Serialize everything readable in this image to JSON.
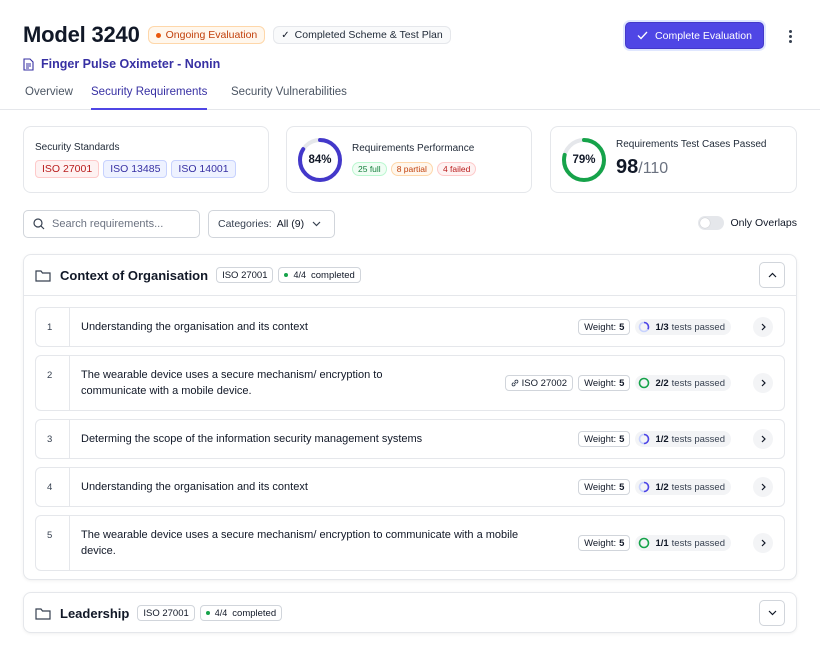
{
  "header": {
    "model_title": "Model 3240",
    "status_badge": "Ongoing Evaluation",
    "scheme_badge": "Completed Scheme & Test Plan",
    "device_name": "Finger Pulse Oximeter - Nonin",
    "complete_button": "Complete Evaluation"
  },
  "tabs": [
    {
      "label": "Overview",
      "active": false
    },
    {
      "label": "Security Requirements",
      "active": true
    },
    {
      "label": "Security Vulnerabilities",
      "active": false
    }
  ],
  "cards": {
    "standards": {
      "label": "Security Standards",
      "items": [
        "ISO 27001",
        "ISO 13485",
        "ISO 14001"
      ]
    },
    "performance": {
      "label": "Requirements Performance",
      "percent_label": "84%",
      "percent": 84,
      "full": "25 full",
      "partial": "8 partial",
      "failed": "4 failed"
    },
    "test_cases": {
      "label": "Requirements Test Cases Passed",
      "percent_label": "79%",
      "percent": 79,
      "passed": "98",
      "total": "/110"
    }
  },
  "filters": {
    "search_placeholder": "Search requirements...",
    "categories_label": "Categories:",
    "categories_value": "All (9)",
    "only_overlaps_label": "Only Overlaps"
  },
  "sections": [
    {
      "title": "Context of Organisation",
      "standard": "ISO 27001",
      "count": "4/4",
      "status": "completed",
      "rows": [
        {
          "num": "1",
          "text": "Understanding the organisation and its context",
          "overlap": "",
          "weight_label": "Weight:",
          "weight": "5",
          "passed": "1/3",
          "passed_label": "tests passed",
          "progress": 0.33
        },
        {
          "num": "2",
          "text": "The wearable device uses a secure mechanism/ encryption to communicate with a mobile device.",
          "overlap": "ISO 27002",
          "weight_label": "Weight:",
          "weight": "5",
          "passed": "2/2",
          "passed_label": "tests passed",
          "progress": 1.0
        },
        {
          "num": "3",
          "text": "Determing the scope of the information security management systems",
          "overlap": "",
          "weight_label": "Weight:",
          "weight": "5",
          "passed": "1/2",
          "passed_label": "tests passed",
          "progress": 0.5
        },
        {
          "num": "4",
          "text": "Understanding the organisation and its context",
          "overlap": "",
          "weight_label": "Weight:",
          "weight": "5",
          "passed": "1/2",
          "passed_label": "tests passed",
          "progress": 0.5
        },
        {
          "num": "5",
          "text": "The wearable device uses a secure mechanism/ encryption to communicate with a mobile device.",
          "overlap": "",
          "weight_label": "Weight:",
          "weight": "5",
          "passed": "1/1",
          "passed_label": "tests passed",
          "progress": 1.0
        }
      ]
    },
    {
      "title": "Leadership",
      "standard": "ISO 27001",
      "count": "4/4",
      "status": "completed"
    }
  ],
  "colors": {
    "accent": "#4f46e5",
    "success": "#16a34a",
    "warning": "#c2410c",
    "danger": "#b91c1c"
  },
  "icons": [
    "check-icon",
    "document-icon",
    "kebab-icon",
    "search-icon",
    "chevron-down-icon",
    "folder-icon",
    "chevron-up-icon",
    "chevron-right-icon",
    "link-icon"
  ]
}
